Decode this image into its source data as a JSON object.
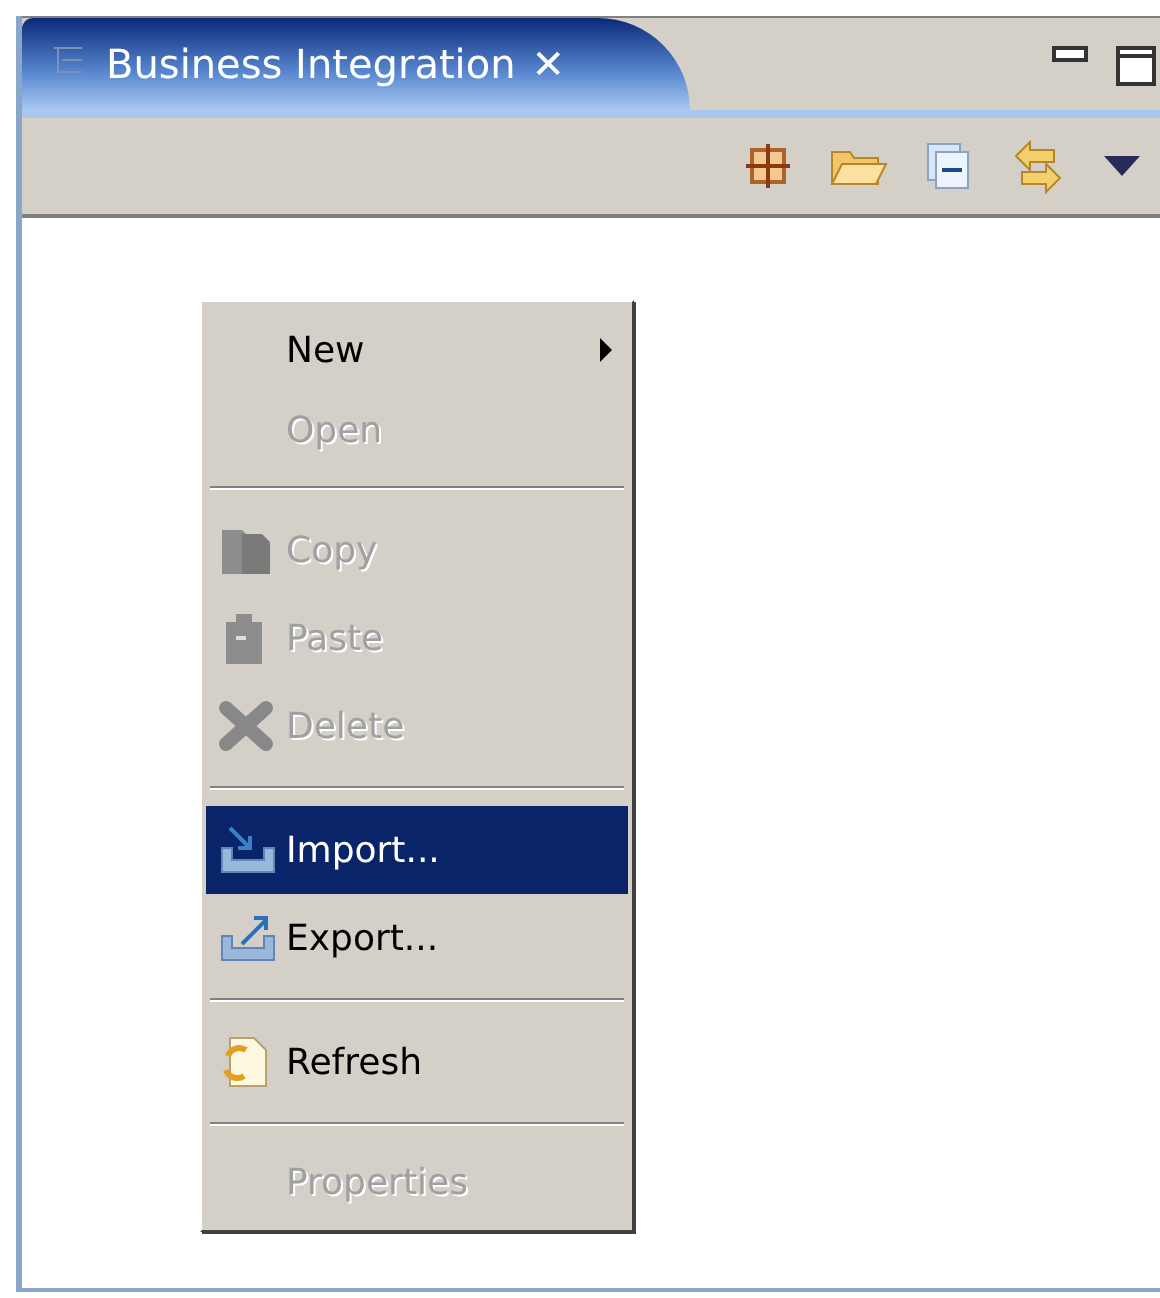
{
  "view": {
    "title": "Business Integration",
    "close_glyph": "✕"
  },
  "toolbar": [
    {
      "kind": "grid"
    },
    {
      "kind": "folder"
    },
    {
      "kind": "collapse"
    },
    {
      "kind": "link"
    },
    {
      "kind": "dropdown"
    }
  ],
  "context_menu": [
    {
      "kind": "plain",
      "label": "New",
      "disabled": false,
      "selected": false,
      "submenu": true
    },
    {
      "kind": "plain",
      "label": "Open",
      "disabled": true,
      "selected": false,
      "submenu": false
    },
    {
      "kind": "separator"
    },
    {
      "kind": "copy",
      "label": "Copy",
      "disabled": true,
      "selected": false,
      "submenu": false
    },
    {
      "kind": "paste",
      "label": "Paste",
      "disabled": true,
      "selected": false,
      "submenu": false
    },
    {
      "kind": "delete",
      "label": "Delete",
      "disabled": true,
      "selected": false,
      "submenu": false
    },
    {
      "kind": "separator"
    },
    {
      "kind": "import",
      "label": "Import...",
      "disabled": false,
      "selected": true,
      "submenu": false
    },
    {
      "kind": "export",
      "label": "Export...",
      "disabled": false,
      "selected": false,
      "submenu": false
    },
    {
      "kind": "separator"
    },
    {
      "kind": "refresh",
      "label": "Refresh",
      "disabled": false,
      "selected": false,
      "submenu": false
    },
    {
      "kind": "separator"
    },
    {
      "kind": "plain",
      "label": "Properties",
      "disabled": true,
      "selected": false,
      "submenu": false
    }
  ]
}
